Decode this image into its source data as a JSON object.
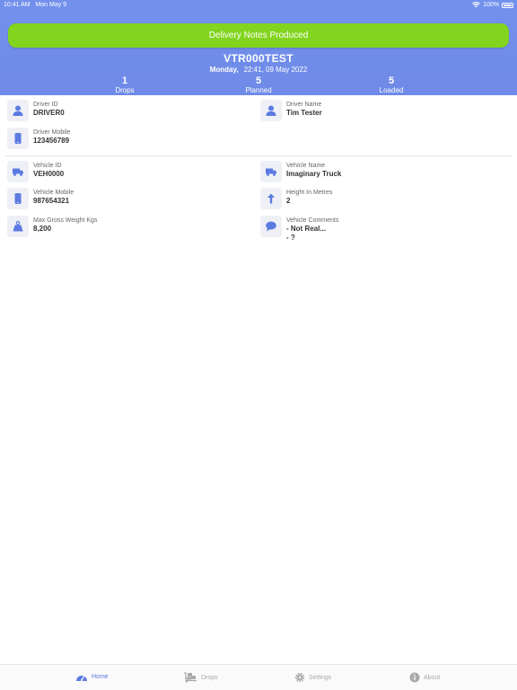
{
  "status_bar": {
    "time": "10:41 AM",
    "date": "Mon May 9",
    "battery": "100%"
  },
  "banner": {
    "label": "Delivery Notes Produced"
  },
  "vehicle_header": {
    "title": "VTR000TEST",
    "day": "Monday,",
    "datetime": "22:41, 09 May 2022"
  },
  "stats": [
    {
      "value": "1",
      "label": "Drops"
    },
    {
      "value": "5",
      "label": "Planned"
    },
    {
      "value": "5",
      "label": "Loaded"
    }
  ],
  "driver": {
    "id_label": "Driver ID",
    "id_value": "DRIVER0",
    "name_label": "Driver Name",
    "name_value": "Tim Tester",
    "mobile_label": "Driver Mobile",
    "mobile_value": "123456789"
  },
  "vehicle": {
    "id_label": "Vehicle ID",
    "id_value": "VEH0000",
    "name_label": "Vehicle Name",
    "name_value": "Imaginary Truck",
    "mobile_label": "Vehicle Mobile",
    "mobile_value": "987654321",
    "height_label": "Height In Metres",
    "height_value": "2",
    "weight_label": "Max Gross Weight Kgs",
    "weight_value": "8,200",
    "comments_label": "Vehicle Comments",
    "comments_line1": "- Not Real...",
    "comments_line2": "- ?"
  },
  "tabs": [
    {
      "label": "Home",
      "icon": "gauge-icon"
    },
    {
      "label": "Drops",
      "icon": "dolly-icon"
    },
    {
      "label": "Settings",
      "icon": "gear-icon"
    },
    {
      "label": "About",
      "icon": "info-icon"
    }
  ],
  "colors": {
    "header": "#7391ec",
    "banner": "#82d41e",
    "icon": "#5b7be0",
    "tab_active": "#5b7be0",
    "tab_inactive": "#aaaaaa"
  }
}
